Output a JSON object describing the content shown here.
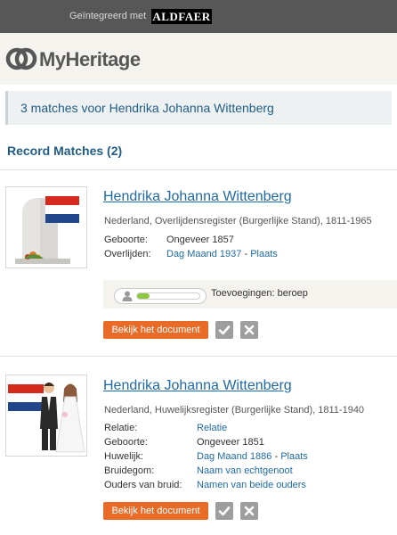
{
  "topbar": {
    "integrated_label": "Geïntegreerd met",
    "aldfaer_logo": "ALDFAER"
  },
  "brand": {
    "logo_text": "MyHeritage"
  },
  "headline": "3 matches voor Hendrika Johanna Wittenberg",
  "section_title": "Record Matches (2)",
  "records": [
    {
      "name": "Hendrika Johanna Wittenberg",
      "source": "Nederland, Overlijdensregister (Burgerlijke Stand), 1811-1965",
      "fields": [
        {
          "label": "Geboorte:",
          "value": "Ongeveer 1857"
        },
        {
          "label": "Overlijden:",
          "value": "Dag Maand 1937",
          "sep": " - ",
          "link2": "Plaats"
        }
      ],
      "progress": {
        "fraction": 0.2,
        "additions": "Toevoegingen: beroep"
      },
      "view_button": "Bekijk het document",
      "icon": "tombstone-with-dutch-flag-icon"
    },
    {
      "name": "Hendrika Johanna Wittenberg",
      "source": "Nederland, Huwelijksregister (Burgerlijke Stand), 1811-1940",
      "fields": [
        {
          "label": "Relatie:",
          "value": "Relatie"
        },
        {
          "label": "Geboorte:",
          "value": "Ongeveer 1851"
        },
        {
          "label": "Huwelijk:",
          "value": "Dag Maand 1886",
          "sep": " - ",
          "link2": "Plaats"
        },
        {
          "label": "Bruidegom:",
          "value": "Naam van echtgenoot"
        },
        {
          "label": "Ouders van bruid:",
          "value": "Namen van beide ouders"
        }
      ],
      "view_button": "Bekijk het document",
      "icon": "wedding-couple-with-dutch-flag-icon"
    }
  ],
  "colors": {
    "accent_blue": "#1f6aa5",
    "button_orange": "#e86b28",
    "progress_green": "#8cc63f"
  }
}
